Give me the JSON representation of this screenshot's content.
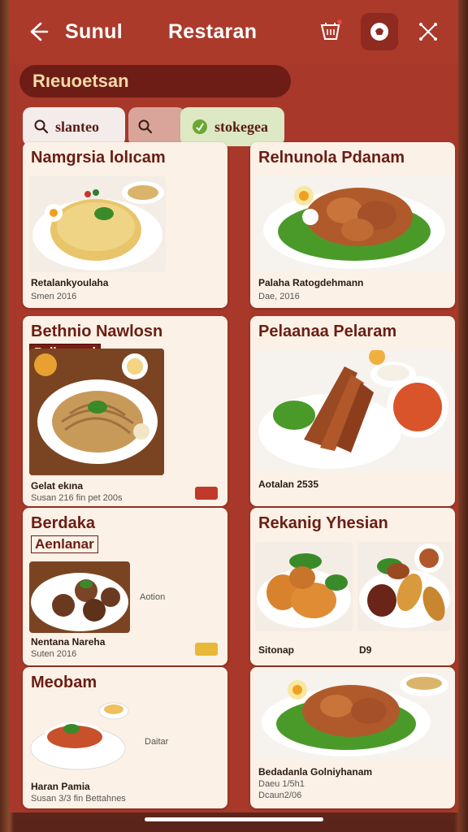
{
  "header": {
    "left_title": "Sunul",
    "center_title": "Restaran"
  },
  "section": {
    "label": "Rıeuoetsan"
  },
  "filters": [
    {
      "label": "slanteo"
    },
    {
      "label": ""
    },
    {
      "label": "stokegea"
    }
  ],
  "cards": [
    {
      "title": "Namgrsia lolıcam",
      "line1": "Retalankyoulaha",
      "line2": "Smen 2016"
    },
    {
      "title": "Relnunola Pdanam",
      "line1": "Palaha Ratogdehmann",
      "line2": "Dae, 2016"
    },
    {
      "title": "Bethnio Nawlosn",
      "tag": "Bellananul",
      "line1": "Gelat ekına",
      "line2": "Susan 216 fin pet 200s"
    },
    {
      "title": "Pelaanaa Pelaram",
      "line1": "Aotalan 2535",
      "line2": ""
    },
    {
      "title": "Berdaka",
      "tag": "Aenlanar",
      "side": "Aotion",
      "line1": "Nentana Nareha",
      "line2": "Suten 2016"
    },
    {
      "title": "Rekanig Yhesian",
      "line1": "Sitonap",
      "side": "D9",
      "line2": ""
    },
    {
      "title": "Meobam",
      "side": "Daitar",
      "line1": "Haran Pamia",
      "line2": "Susan 3/3 fin Bettahnes"
    },
    {
      "title": "",
      "line1": "Bedadanla Golniyhanam",
      "line2": "Daeu 1/5h1",
      "line3": "Dcaun2/06"
    }
  ],
  "colors": {
    "brand": "#ab3a2b",
    "card_bg": "#fbf1e6",
    "title_text": "#6a1d14",
    "badge_red": "#c0392b",
    "badge_yellow": "#e8b838"
  },
  "icons": {
    "back": "arrow-left-icon",
    "cart": "cart-icon",
    "profile": "chef-icon",
    "close": "share-x-icon"
  }
}
